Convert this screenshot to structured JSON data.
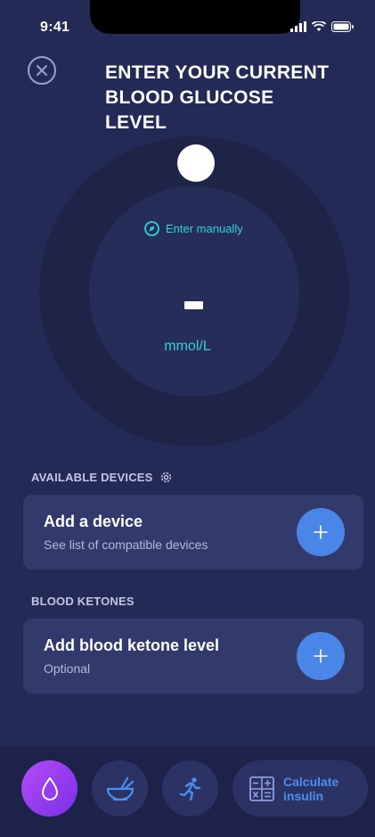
{
  "status_bar": {
    "time": "9:41"
  },
  "header": {
    "title": "ENTER YOUR CURRENT BLOOD GLUCOSE LEVEL"
  },
  "dial": {
    "manual_label": "Enter manually",
    "value": "-",
    "unit": "mmol/L"
  },
  "devices": {
    "section_label": "AVAILABLE DEVICES",
    "card_title": "Add a device",
    "card_subtitle": "See list of compatible devices"
  },
  "ketones": {
    "section_label": "BLOOD KETONES",
    "card_title": "Add blood ketone level",
    "card_subtitle": "Optional"
  },
  "bottom_nav": {
    "calculate_label": "Calculate insulin",
    "active": "glucose"
  },
  "colors": {
    "background": "#232a55",
    "accent_cyan": "#2fd3d8",
    "button_blue": "#4a85e8",
    "active_purple": "#9a3ef0"
  }
}
